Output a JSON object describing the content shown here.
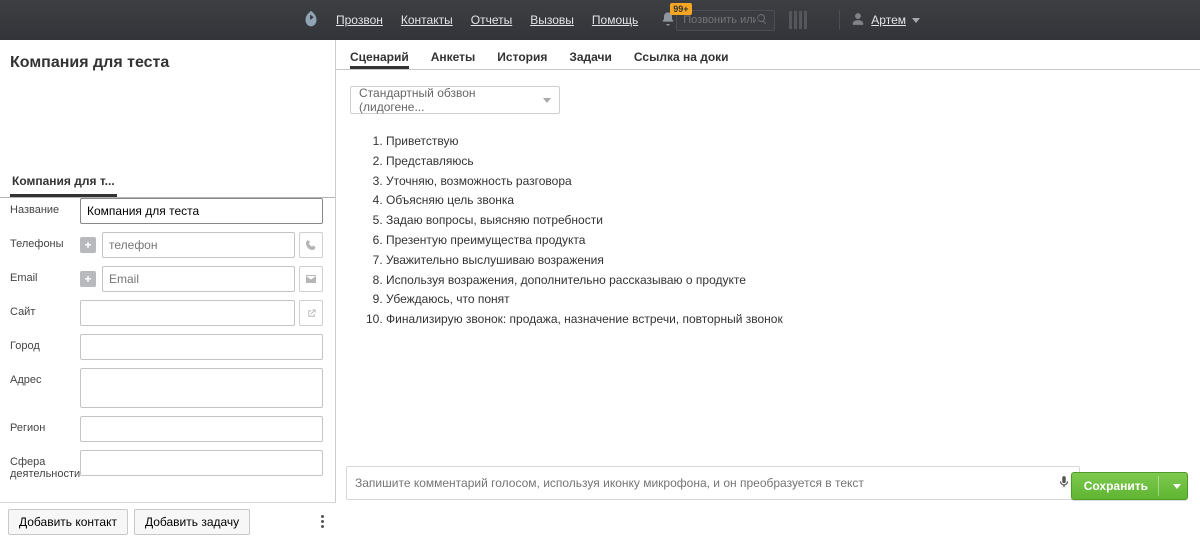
{
  "nav": {
    "items": [
      "Прозвон",
      "Контакты",
      "Отчеты",
      "Вызовы",
      "Помощь"
    ],
    "badge": "99+",
    "search_placeholder": "Позвонить или найти",
    "user": "Артем"
  },
  "left": {
    "title": "Компания для теста",
    "tab": "Компания для т...",
    "fields": {
      "name_label": "Название",
      "name_value": "Компания для теста",
      "phone_label": "Телефоны",
      "phone_placeholder": "телефон",
      "email_label": "Email",
      "email_placeholder": "Email",
      "site_label": "Сайт",
      "city_label": "Город",
      "address_label": "Адрес",
      "region_label": "Регион",
      "sphere_label": "Сфера деятельности"
    },
    "buttons": {
      "add_contact": "Добавить контакт",
      "add_task": "Добавить задачу"
    }
  },
  "right": {
    "tabs": [
      "Сценарий",
      "Анкеты",
      "История",
      "Задачи",
      "Ссылка на доки"
    ],
    "active_tab": 0,
    "scenario_select": "Стандартный обзвон (лидогене...",
    "steps": [
      "Приветствую",
      "Представляюсь",
      "Уточняю, возможность разговора",
      "Объясняю цель звонка",
      "Задаю вопросы, выясняю потребности",
      "Презентую преимущества продукта",
      "Уважительно выслушиваю возражения",
      "Используя возражения, дополнительно рассказываю о продукте",
      "Убеждаюсь, что понят",
      "Финализирую звонок: продажа, назначение встречи, повторный звонок"
    ],
    "comment_placeholder": "Запишите комментарий голосом, используя иконку микрофона, и он преобразуется в текст",
    "save": "Сохранить"
  }
}
